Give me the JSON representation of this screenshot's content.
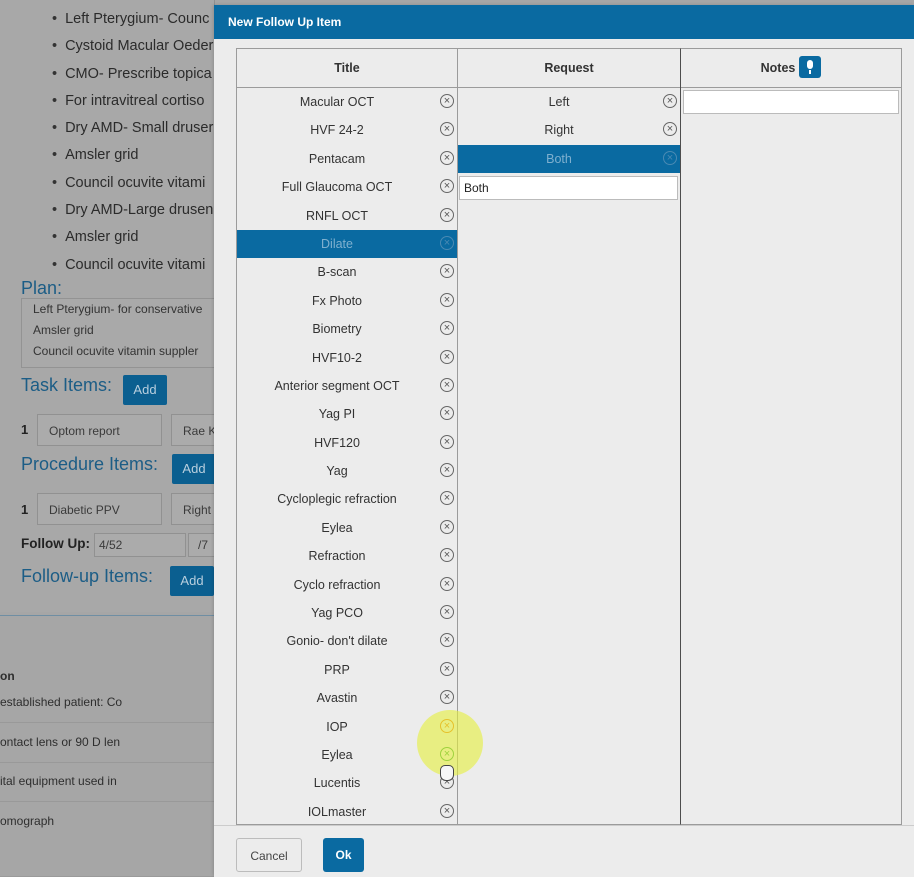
{
  "background": {
    "bullets": [
      "Left Pterygium- Counc",
      "Cystoid Macular Oeder",
      "CMO- Prescribe topica",
      "For intravitreal cortiso",
      "Dry AMD- Small druser",
      "Amsler grid",
      "Council ocuvite vitami",
      "Dry AMD-Large drusen",
      "Amsler grid",
      "Council ocuvite vitami"
    ],
    "plan_label": "Plan:",
    "plan_lines": [
      "Left Pterygium- for conservative",
      "Amsler grid",
      "Council ocuvite vitamin suppler"
    ],
    "task_items_label": "Task Items:",
    "procedure_items_label": "Procedure Items:",
    "followup_items_label": "Follow-up Items:",
    "add_label": "Add",
    "task_row": {
      "num": "1",
      "field1": "Optom report",
      "field2": "Rae K"
    },
    "procedure_row": {
      "num": "1",
      "field1": "Diabetic PPV",
      "field2": "Right"
    },
    "follow_up_label": "Follow Up:",
    "follow_up_value": "4/52",
    "follow_up_value2": "/7",
    "bottom_texts": [
      "on",
      "established patient: Co",
      "ontact lens or 90 D len",
      "ital equipment used in",
      "omograph"
    ]
  },
  "modal": {
    "title": "New Follow Up Item",
    "columns": {
      "title": "Title",
      "request": "Request",
      "notes": "Notes"
    },
    "title_items": [
      "Macular OCT",
      "HVF 24-2",
      "Pentacam",
      "Full Glaucoma OCT",
      "RNFL OCT",
      "Dilate",
      "B-scan",
      "Fx Photo",
      "Biometry",
      "HVF10-2",
      "Anterior segment OCT",
      "Yag PI",
      "HVF120",
      "Yag",
      "Cycloplegic refraction",
      "Eylea",
      "Refraction",
      "Cyclo refraction",
      "Yag PCO",
      "Gonio- don't dilate",
      "PRP",
      "Avastin",
      "IOP",
      "Eylea",
      "Lucentis",
      "IOLmaster"
    ],
    "title_selected": "Dilate",
    "request_items": [
      "Left",
      "Right",
      "Both"
    ],
    "request_selected": "Both",
    "request_input_value": "Both",
    "notes_value": "",
    "remove_symbol": "×",
    "cancel_label": "Cancel",
    "ok_label": "Ok",
    "colors": {
      "accent": "#0a6aa1",
      "highlight": "#e6f03c",
      "orange_icon": "#e47a12",
      "green_icon": "#35a540"
    }
  }
}
